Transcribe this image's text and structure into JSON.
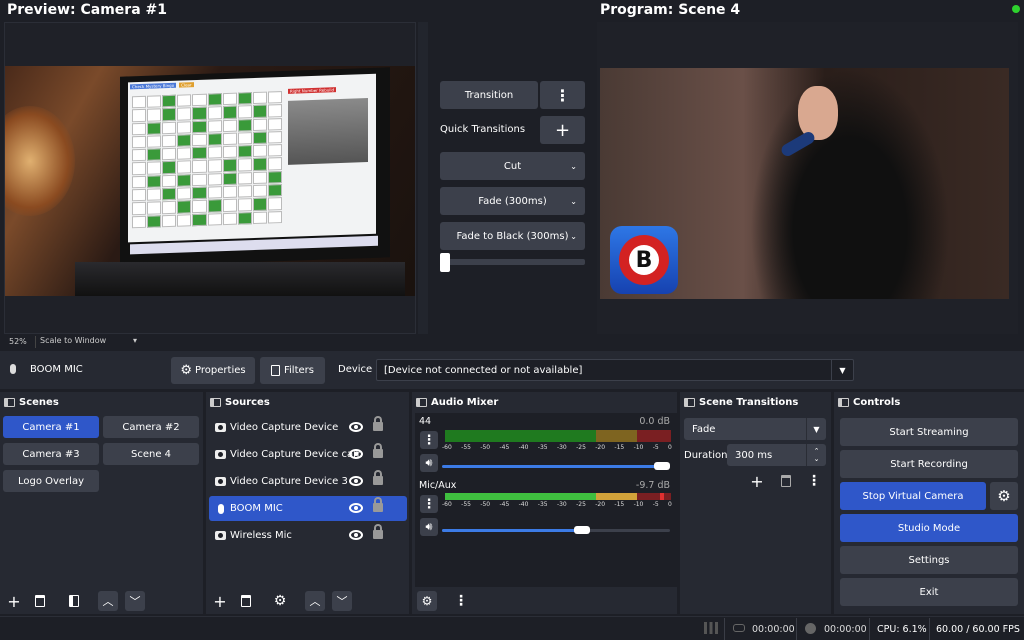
{
  "preview": {
    "title": "Preview: Camera #1",
    "zoom": "52%",
    "scale_mode": "Scale to Window",
    "bingo_buttons": [
      "Check Mystery Bingo",
      "Clear",
      "Right Number Rebuild"
    ]
  },
  "program": {
    "title": "Program: Scene 4"
  },
  "transitions": {
    "transition_label": "Transition",
    "quick_label": "Quick Transitions",
    "cut": "Cut",
    "fade": "Fade (300ms)",
    "fade_black": "Fade to Black (300ms)"
  },
  "sourcebar": {
    "source_name": "BOOM MIC",
    "properties": "Properties",
    "filters": "Filters",
    "device_label": "Device",
    "device_value": "[Device not connected or not available]"
  },
  "scenes": {
    "title": "Scenes",
    "items": [
      "Camera #1",
      "Camera #2",
      "Camera #3",
      "Scene 4",
      "Logo Overlay"
    ]
  },
  "sources": {
    "title": "Sources",
    "items": [
      "Video Capture Device",
      "Video Capture Device cam",
      "Video Capture Device 3",
      "BOOM MIC",
      "Wireless Mic"
    ]
  },
  "mixer": {
    "title": "Audio Mixer",
    "channels": [
      {
        "name": "44",
        "db": "0.0 dB",
        "volume": 1.0
      },
      {
        "name": "Mic/Aux",
        "db": "-9.7 dB",
        "volume": 0.65
      }
    ],
    "scale": [
      "-60",
      "-55",
      "-50",
      "-45",
      "-40",
      "-35",
      "-30",
      "-25",
      "-20",
      "-15",
      "-10",
      "-5",
      "0"
    ]
  },
  "scene_transitions": {
    "title": "Scene Transitions",
    "type": "Fade",
    "duration_label": "Duration",
    "duration_value": "300 ms"
  },
  "controls": {
    "title": "Controls",
    "start_streaming": "Start Streaming",
    "start_recording": "Start Recording",
    "stop_virtual_camera": "Stop Virtual Camera",
    "studio_mode": "Studio Mode",
    "settings": "Settings",
    "exit": "Exit"
  },
  "statusbar": {
    "stream_time": "00:00:00",
    "record_time": "00:00:00",
    "cpu": "CPU: 6.1%",
    "fps": "60.00 / 60.00 FPS"
  },
  "colors": {
    "accent": "#2f57c9",
    "panel": "#262932",
    "background": "#1d1f26",
    "button": "#3c404b",
    "meter_green": "#3fbf3f",
    "meter_yellow": "#d2a23a",
    "meter_red": "#c0393b"
  }
}
